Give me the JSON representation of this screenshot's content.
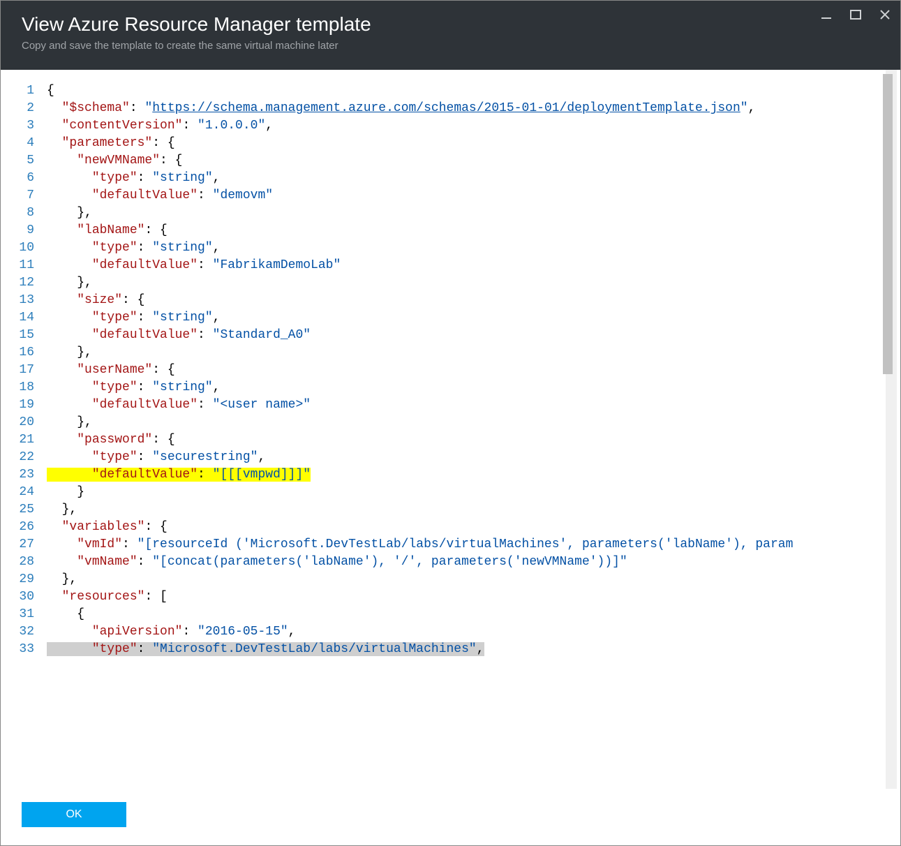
{
  "window": {
    "title": "View Azure Resource Manager template",
    "subtitle": "Copy and save the template to create the same virtual machine later",
    "accent_color": "#ff8c00"
  },
  "buttons": {
    "ok": "OK",
    "minimize": "minimize-icon",
    "maximize": "maximize-icon",
    "close": "close-icon"
  },
  "code": {
    "line_count": 33,
    "highlight_yellow_line": 23,
    "highlight_gray_line": 33,
    "lines": [
      {
        "n": 1,
        "tokens": [
          {
            "t": "punc",
            "v": "{"
          }
        ]
      },
      {
        "n": 2,
        "tokens": [
          {
            "t": "punc",
            "v": "  "
          },
          {
            "t": "key",
            "v": "\"$schema\""
          },
          {
            "t": "punc",
            "v": ": "
          },
          {
            "t": "str",
            "v": "\""
          },
          {
            "t": "link",
            "v": "https://schema.management.azure.com/schemas/2015-01-01/deploymentTemplate.json"
          },
          {
            "t": "str",
            "v": "\""
          },
          {
            "t": "punc",
            "v": ","
          }
        ]
      },
      {
        "n": 3,
        "tokens": [
          {
            "t": "punc",
            "v": "  "
          },
          {
            "t": "key",
            "v": "\"contentVersion\""
          },
          {
            "t": "punc",
            "v": ": "
          },
          {
            "t": "str",
            "v": "\"1.0.0.0\""
          },
          {
            "t": "punc",
            "v": ","
          }
        ]
      },
      {
        "n": 4,
        "tokens": [
          {
            "t": "punc",
            "v": "  "
          },
          {
            "t": "key",
            "v": "\"parameters\""
          },
          {
            "t": "punc",
            "v": ": {"
          }
        ]
      },
      {
        "n": 5,
        "tokens": [
          {
            "t": "punc",
            "v": "    "
          },
          {
            "t": "key",
            "v": "\"newVMName\""
          },
          {
            "t": "punc",
            "v": ": {"
          }
        ]
      },
      {
        "n": 6,
        "tokens": [
          {
            "t": "punc",
            "v": "      "
          },
          {
            "t": "key",
            "v": "\"type\""
          },
          {
            "t": "punc",
            "v": ": "
          },
          {
            "t": "str",
            "v": "\"string\""
          },
          {
            "t": "punc",
            "v": ","
          }
        ]
      },
      {
        "n": 7,
        "tokens": [
          {
            "t": "punc",
            "v": "      "
          },
          {
            "t": "key",
            "v": "\"defaultValue\""
          },
          {
            "t": "punc",
            "v": ": "
          },
          {
            "t": "str",
            "v": "\"demovm\""
          }
        ]
      },
      {
        "n": 8,
        "tokens": [
          {
            "t": "punc",
            "v": "    },"
          }
        ]
      },
      {
        "n": 9,
        "tokens": [
          {
            "t": "punc",
            "v": "    "
          },
          {
            "t": "key",
            "v": "\"labName\""
          },
          {
            "t": "punc",
            "v": ": {"
          }
        ]
      },
      {
        "n": 10,
        "tokens": [
          {
            "t": "punc",
            "v": "      "
          },
          {
            "t": "key",
            "v": "\"type\""
          },
          {
            "t": "punc",
            "v": ": "
          },
          {
            "t": "str",
            "v": "\"string\""
          },
          {
            "t": "punc",
            "v": ","
          }
        ]
      },
      {
        "n": 11,
        "tokens": [
          {
            "t": "punc",
            "v": "      "
          },
          {
            "t": "key",
            "v": "\"defaultValue\""
          },
          {
            "t": "punc",
            "v": ": "
          },
          {
            "t": "str",
            "v": "\"FabrikamDemoLab\""
          }
        ]
      },
      {
        "n": 12,
        "tokens": [
          {
            "t": "punc",
            "v": "    },"
          }
        ]
      },
      {
        "n": 13,
        "tokens": [
          {
            "t": "punc",
            "v": "    "
          },
          {
            "t": "key",
            "v": "\"size\""
          },
          {
            "t": "punc",
            "v": ": {"
          }
        ]
      },
      {
        "n": 14,
        "tokens": [
          {
            "t": "punc",
            "v": "      "
          },
          {
            "t": "key",
            "v": "\"type\""
          },
          {
            "t": "punc",
            "v": ": "
          },
          {
            "t": "str",
            "v": "\"string\""
          },
          {
            "t": "punc",
            "v": ","
          }
        ]
      },
      {
        "n": 15,
        "tokens": [
          {
            "t": "punc",
            "v": "      "
          },
          {
            "t": "key",
            "v": "\"defaultValue\""
          },
          {
            "t": "punc",
            "v": ": "
          },
          {
            "t": "str",
            "v": "\"Standard_A0\""
          }
        ]
      },
      {
        "n": 16,
        "tokens": [
          {
            "t": "punc",
            "v": "    },"
          }
        ]
      },
      {
        "n": 17,
        "tokens": [
          {
            "t": "punc",
            "v": "    "
          },
          {
            "t": "key",
            "v": "\"userName\""
          },
          {
            "t": "punc",
            "v": ": {"
          }
        ]
      },
      {
        "n": 18,
        "tokens": [
          {
            "t": "punc",
            "v": "      "
          },
          {
            "t": "key",
            "v": "\"type\""
          },
          {
            "t": "punc",
            "v": ": "
          },
          {
            "t": "str",
            "v": "\"string\""
          },
          {
            "t": "punc",
            "v": ","
          }
        ]
      },
      {
        "n": 19,
        "tokens": [
          {
            "t": "punc",
            "v": "      "
          },
          {
            "t": "key",
            "v": "\"defaultValue\""
          },
          {
            "t": "punc",
            "v": ": "
          },
          {
            "t": "str",
            "v": "\"<user name>\""
          }
        ]
      },
      {
        "n": 20,
        "tokens": [
          {
            "t": "punc",
            "v": "    },"
          }
        ]
      },
      {
        "n": 21,
        "tokens": [
          {
            "t": "punc",
            "v": "    "
          },
          {
            "t": "key",
            "v": "\"password\""
          },
          {
            "t": "punc",
            "v": ": {"
          }
        ]
      },
      {
        "n": 22,
        "tokens": [
          {
            "t": "punc",
            "v": "      "
          },
          {
            "t": "key",
            "v": "\"type\""
          },
          {
            "t": "punc",
            "v": ": "
          },
          {
            "t": "str",
            "v": "\"securestring\""
          },
          {
            "t": "punc",
            "v": ","
          }
        ]
      },
      {
        "n": 23,
        "tokens": [
          {
            "t": "punc",
            "v": "      "
          },
          {
            "t": "key",
            "v": "\"defaultValue\""
          },
          {
            "t": "punc",
            "v": ": "
          },
          {
            "t": "str",
            "v": "\"[[[vmpwd]]]\""
          }
        ],
        "hl": "yellow"
      },
      {
        "n": 24,
        "tokens": [
          {
            "t": "punc",
            "v": "    }"
          }
        ]
      },
      {
        "n": 25,
        "tokens": [
          {
            "t": "punc",
            "v": "  },"
          }
        ]
      },
      {
        "n": 26,
        "tokens": [
          {
            "t": "punc",
            "v": "  "
          },
          {
            "t": "key",
            "v": "\"variables\""
          },
          {
            "t": "punc",
            "v": ": {"
          }
        ]
      },
      {
        "n": 27,
        "tokens": [
          {
            "t": "punc",
            "v": "    "
          },
          {
            "t": "key",
            "v": "\"vmId\""
          },
          {
            "t": "punc",
            "v": ": "
          },
          {
            "t": "str",
            "v": "\"[resourceId ('Microsoft.DevTestLab/labs/virtualMachines', parameters('labName'), param"
          }
        ]
      },
      {
        "n": 28,
        "tokens": [
          {
            "t": "punc",
            "v": "    "
          },
          {
            "t": "key",
            "v": "\"vmName\""
          },
          {
            "t": "punc",
            "v": ": "
          },
          {
            "t": "str",
            "v": "\"[concat(parameters('labName'), '/', parameters('newVMName'))]\""
          }
        ]
      },
      {
        "n": 29,
        "tokens": [
          {
            "t": "punc",
            "v": "  },"
          }
        ]
      },
      {
        "n": 30,
        "tokens": [
          {
            "t": "punc",
            "v": "  "
          },
          {
            "t": "key",
            "v": "\"resources\""
          },
          {
            "t": "punc",
            "v": ": ["
          }
        ]
      },
      {
        "n": 31,
        "tokens": [
          {
            "t": "punc",
            "v": "    {"
          }
        ]
      },
      {
        "n": 32,
        "tokens": [
          {
            "t": "punc",
            "v": "      "
          },
          {
            "t": "key",
            "v": "\"apiVersion\""
          },
          {
            "t": "punc",
            "v": ": "
          },
          {
            "t": "str",
            "v": "\"2016-05-15\""
          },
          {
            "t": "punc",
            "v": ","
          }
        ]
      },
      {
        "n": 33,
        "tokens": [
          {
            "t": "punc",
            "v": "      "
          },
          {
            "t": "key",
            "v": "\"type\""
          },
          {
            "t": "punc",
            "v": ": "
          },
          {
            "t": "str",
            "v": "\"Microsoft.DevTestLab/labs/virtualMachines\""
          },
          {
            "t": "punc",
            "v": ","
          }
        ],
        "hl": "gray"
      }
    ]
  }
}
